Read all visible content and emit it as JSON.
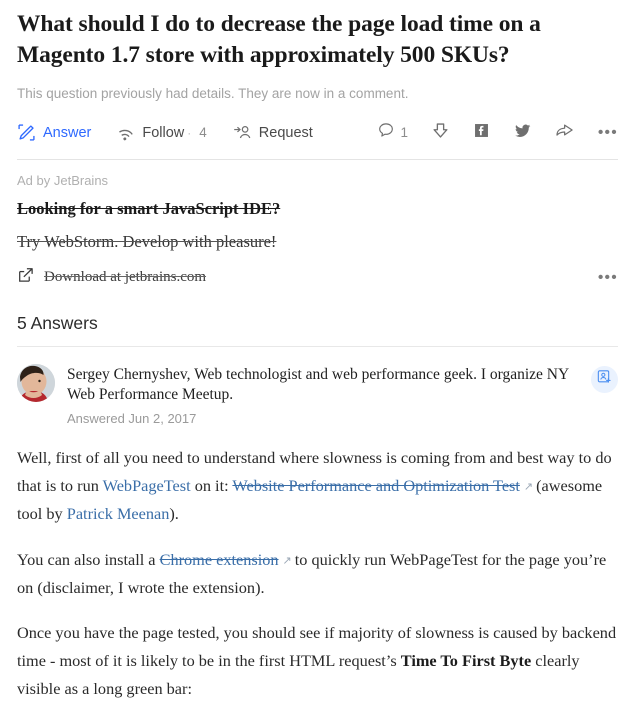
{
  "question": {
    "title": "What should I do to decrease the page load time on a Magento 1.7 store with approximately 500 SKUs?",
    "subtitle": "This question previously had details. They are now in a comment."
  },
  "actions": {
    "answer_label": "Answer",
    "follow_label": "Follow",
    "follow_separator": "·",
    "follow_count": "4",
    "request_label": "Request",
    "comment_count": "1",
    "more_label": "•••",
    "icons": {
      "answer": "pencil-answer-icon",
      "follow": "rss-follow-icon",
      "request": "request-person-icon",
      "comment": "comment-bubble-icon",
      "downvote": "downvote-arrow-icon",
      "facebook": "facebook-share-icon",
      "twitter": "twitter-share-icon",
      "share": "share-arrow-icon",
      "more": "more-options-icon"
    }
  },
  "ad": {
    "by_label": "Ad by JetBrains",
    "headline": "Looking for a smart JavaScript IDE?",
    "subline": "Try WebStorm. Develop with pleasure!",
    "cta": "Download at jetbrains.com",
    "more_label": "•••"
  },
  "answers": {
    "header": "5 Answers",
    "items": [
      {
        "author_name": "Sergey Chernyshev",
        "author_bio": ", Web technologist and web performance geek. I organize NY Web Performance Meetup.",
        "date": "Answered Jun 2, 2017",
        "follow_icon": "add-person-card-icon",
        "paragraphs": [
          {
            "id": "p1",
            "parts": [
              {
                "type": "text",
                "text": "Well, first of all you need to understand where slowness is coming from and best way to do that is to run "
              },
              {
                "type": "link",
                "text": "WebPageTest"
              },
              {
                "type": "text",
                "text": " on it: "
              },
              {
                "type": "link-struck",
                "text": "Website Performance and Optimization Test"
              },
              {
                "type": "ext-icon",
                "text": "↗"
              },
              {
                "type": "text",
                "text": "(awesome tool by "
              },
              {
                "type": "link",
                "text": "Patrick Meenan"
              },
              {
                "type": "text",
                "text": ")."
              }
            ]
          },
          {
            "id": "p2",
            "parts": [
              {
                "type": "text",
                "text": "You can also install a "
              },
              {
                "type": "link-struck",
                "text": "Chrome extension"
              },
              {
                "type": "ext-icon",
                "text": "↗"
              },
              {
                "type": "text",
                "text": "to quickly run WebPageTest for the page you’re on (disclaimer, I wrote the extension)."
              }
            ]
          },
          {
            "id": "p3",
            "parts": [
              {
                "type": "text",
                "text": "Once you have the page tested, you should see if majority of slowness is caused by backend time - most of it is likely to be in the first HTML request’s "
              },
              {
                "type": "bold",
                "text": "Time To First Byte"
              },
              {
                "type": "text",
                "text": " clearly visible as a long green bar:"
              }
            ]
          }
        ]
      }
    ]
  },
  "colors": {
    "link_blue": "#3a6ea8",
    "accent_blue": "#2e69ff",
    "follow_badge_bg": "#eaf2fe",
    "muted_gray": "#a3a3a3",
    "rule_gray": "#e4e4e4"
  }
}
